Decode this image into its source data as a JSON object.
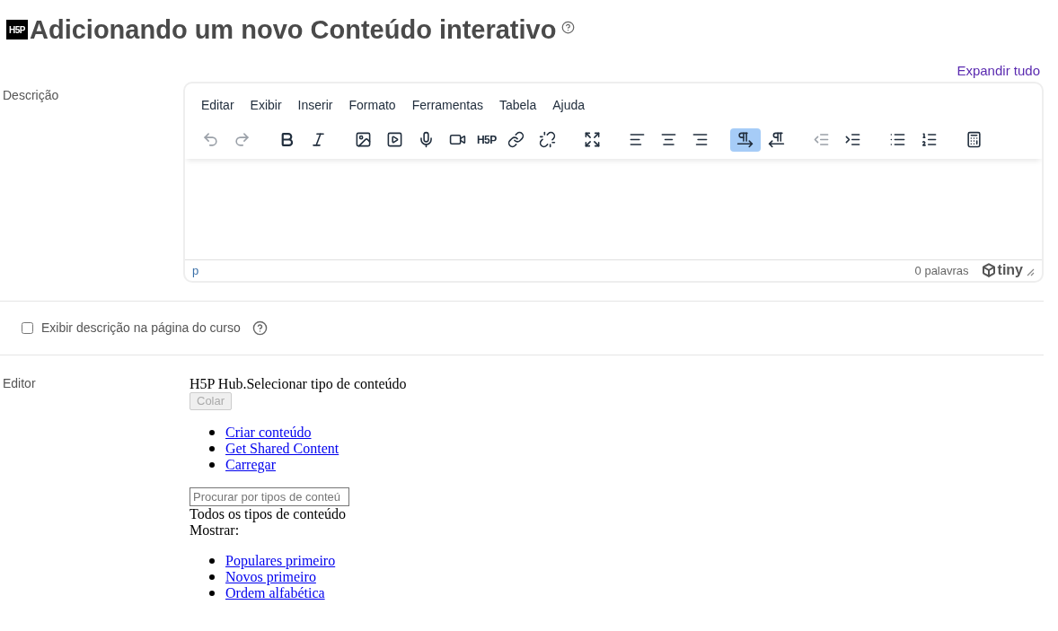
{
  "title": {
    "logo": "H5P",
    "text": "Adicionando um novo Conteúdo interativo"
  },
  "expand_link": "Expandir tudo",
  "description": {
    "label": "Descrição",
    "menu": [
      "Editar",
      "Exibir",
      "Inserir",
      "Formato",
      "Ferramentas",
      "Tabela",
      "Ajuda"
    ],
    "toolbar": [
      [
        {
          "kind": "undo",
          "disabled": true,
          "active": false
        },
        {
          "kind": "redo",
          "disabled": true,
          "active": false
        }
      ],
      [
        {
          "kind": "bold",
          "disabled": false,
          "active": false
        },
        {
          "kind": "italic",
          "disabled": false,
          "active": false
        }
      ],
      [
        {
          "kind": "image",
          "disabled": false,
          "active": false
        },
        {
          "kind": "media",
          "disabled": false,
          "active": false
        },
        {
          "kind": "mic",
          "disabled": false,
          "active": false
        },
        {
          "kind": "video",
          "disabled": false,
          "active": false
        },
        {
          "kind": "h5p",
          "label": "H5P",
          "disabled": false,
          "active": false
        },
        {
          "kind": "link",
          "disabled": false,
          "active": false
        },
        {
          "kind": "unlink",
          "disabled": false,
          "active": false
        }
      ],
      [
        {
          "kind": "fullscreen",
          "disabled": false,
          "active": false
        }
      ],
      [
        {
          "kind": "align-left",
          "disabled": false,
          "active": false
        },
        {
          "kind": "align-center",
          "disabled": false,
          "active": false
        },
        {
          "kind": "align-right",
          "disabled": false,
          "active": false
        }
      ],
      [
        {
          "kind": "ltr",
          "disabled": false,
          "active": true
        },
        {
          "kind": "rtl",
          "disabled": false,
          "active": false
        }
      ],
      [
        {
          "kind": "outdent",
          "disabled": true,
          "active": false
        },
        {
          "kind": "indent",
          "disabled": false,
          "active": false
        }
      ],
      [
        {
          "kind": "bullist",
          "disabled": false,
          "active": false
        },
        {
          "kind": "numlist",
          "disabled": false,
          "active": false
        }
      ],
      [
        {
          "kind": "calculator",
          "disabled": false,
          "active": false
        }
      ]
    ],
    "status_path": "p",
    "word_count": "0 palavras",
    "brand": "tiny"
  },
  "show_description": {
    "label": "Exibir descrição na página do curso",
    "checked": false
  },
  "editor": {
    "label": "Editor",
    "hub_title": "H5P Hub.Selecionar tipo de conteúdo",
    "paste_button": {
      "label": "Colar",
      "disabled": true
    },
    "tabs": [
      "Criar conteúdo",
      "Get Shared Content",
      "Carregar"
    ],
    "search": {
      "placeholder": "Procurar por tipos de conteú"
    },
    "all_types": "Todos os tipos de conteúdo",
    "show_label": "Mostrar:",
    "sort_options": [
      "Populares primeiro",
      "Novos primeiro",
      "Ordem alfabética"
    ]
  }
}
